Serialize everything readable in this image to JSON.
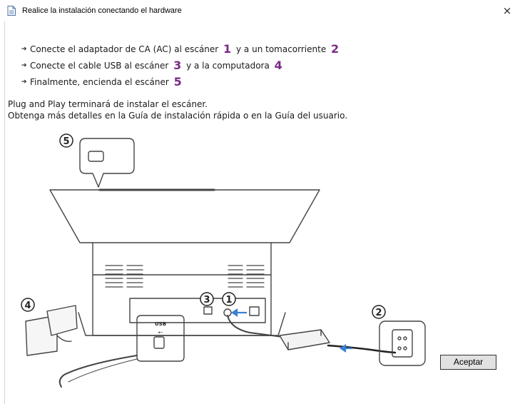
{
  "window": {
    "title": "Realice la instalación conectando el hardware",
    "close_glyph": "×"
  },
  "steps": [
    {
      "parts": [
        {
          "text": "Conecte el adaptador de CA (AC) al escáner "
        },
        {
          "num": "1"
        },
        {
          "text": " y a un tomacorriente "
        },
        {
          "num": "2"
        }
      ]
    },
    {
      "parts": [
        {
          "text": "Conecte el cable USB al escáner "
        },
        {
          "num": "3"
        },
        {
          "text": " y a la computadora "
        },
        {
          "num": "4"
        }
      ]
    },
    {
      "parts": [
        {
          "text": "Finalmente, encienda el escáner "
        },
        {
          "num": "5"
        }
      ]
    }
  ],
  "info": {
    "line1": "Plug and Play terminará de instalar el escáner.",
    "line2": "Obtenga más detalles en la Guía de instalación rápida o en la Guía del usuario."
  },
  "illustration": {
    "callouts": [
      "5",
      "3",
      "1",
      "4",
      "2"
    ],
    "usb_label": "USB",
    "usb_symbol": "⭠"
  },
  "buttons": {
    "accept": "Aceptar"
  },
  "colors": {
    "accent": "#7a2a84",
    "line": "#444444",
    "arrow": "#3a7fd0"
  },
  "icons": {
    "window": "document-icon",
    "close": "close-icon",
    "bullet": "arrow-bullet-icon"
  }
}
